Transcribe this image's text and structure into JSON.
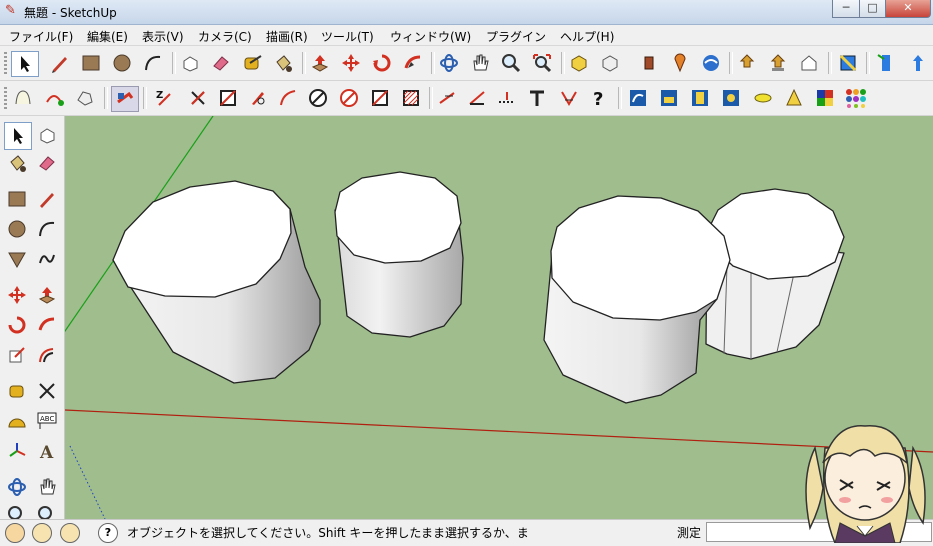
{
  "window": {
    "title": "無題 - SketchUp",
    "minimize": "─",
    "maximize": "□",
    "close": "✕"
  },
  "menu": [
    "ファイル(F)",
    "編集(E)",
    "表示(V)",
    "カメラ(C)",
    "描画(R)",
    "ツール(T)",
    "ウィンドウ(W)",
    "プラグイン",
    "ヘルプ(H)"
  ],
  "toolbar1": [
    "select-icon",
    "pencil-icon",
    "rectangle-icon",
    "circle-icon",
    "arc-icon",
    "make-component-icon",
    "eraser-icon",
    "tape-measure-icon",
    "paint-bucket-icon",
    "push-pull-icon",
    "move-icon",
    "rotate-icon",
    "follow-me-icon",
    "orbit-icon",
    "pan-icon",
    "zoom-icon",
    "zoom-extents-icon",
    "get-models-icon",
    "share-model-icon",
    "component-icon",
    "add-location-icon",
    "google-earth-icon",
    "get-photo-texture-icon",
    "upload-icon",
    "warehouse-icon",
    "section-plane-icon",
    "dynamic-component-icon",
    "axis-icon"
  ],
  "toolbar2": [
    "sandbox-from-contours-icon",
    "sandbox-from-scratch-icon",
    "sandbox-smoove-icon",
    "sandbox-stamp-icon",
    "sandbox-drape-icon",
    "zorro-icon",
    "line-tool-icon",
    "face-tool-icon",
    "knife-tool-icon",
    "curve-tool-icon",
    "circle-slash-icon",
    "circle-slash-red-icon",
    "cross-face-icon",
    "hatch-face-icon",
    "edge-tool-icon",
    "slope-icon",
    "dotted-line-icon",
    "text-tool-icon",
    "angle-icon",
    "help-icon",
    "scene-1-icon",
    "scene-2-icon",
    "scene-3-icon",
    "scene-4-icon",
    "ellipse-icon",
    "cone-icon",
    "color-grid-icon",
    "dots-icon"
  ],
  "leftTools": [
    "select-icon",
    "make-component-icon",
    "paint-bucket-icon",
    "eraser-icon",
    "rectangle-icon",
    "pencil-icon",
    "circle-icon",
    "arc-icon",
    "polygon-icon",
    "freehand-icon",
    "move-icon",
    "push-pull-icon",
    "rotate-icon",
    "follow-me-icon",
    "scale-icon",
    "offset-icon",
    "tape-measure-icon",
    "dimension-icon",
    "protractor-icon",
    "text-icon",
    "axes-icon",
    "3d-text-icon",
    "orbit-icon",
    "pan-icon",
    "zoom-icon",
    "zoom-window-icon"
  ],
  "status": {
    "text": "オブジェクトを選択してください。Shift キーを押したまま選択するか、ま",
    "measure_label": "測定",
    "measure_value": "",
    "help_glyph": "?"
  },
  "colors": {
    "viewport": "#a0bd8e",
    "red_axis": "#b02010",
    "green_axis": "#18a018",
    "blue_axis": "#2040c0"
  }
}
